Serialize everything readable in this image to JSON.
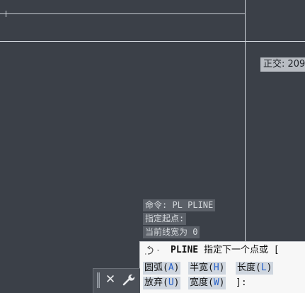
{
  "tooltip": {
    "text": "正交: 209"
  },
  "history": [
    "命令: PL PLINE",
    "指定起点:",
    "当前线宽为 0"
  ],
  "command": {
    "name": "PLINE",
    "prompt_text": " 指定下一个点或 [",
    "options": [
      {
        "label": "圆弧(",
        "key": "A",
        "close": ")"
      },
      {
        "label": "半宽(",
        "key": "H",
        "close": ")"
      },
      {
        "label": "长度(",
        "key": "L",
        "close": ")"
      },
      {
        "label": "放弃(",
        "key": "U",
        "close": ")"
      },
      {
        "label": "宽度(",
        "key": "W",
        "close": ")"
      }
    ],
    "tail": "]:"
  },
  "toolbar": {
    "close_glyph": "✕"
  },
  "icons": {
    "prompt": "command-prompt-icon",
    "customize": "wrench-icon",
    "grip": "grip-icon",
    "close": "close-icon"
  }
}
